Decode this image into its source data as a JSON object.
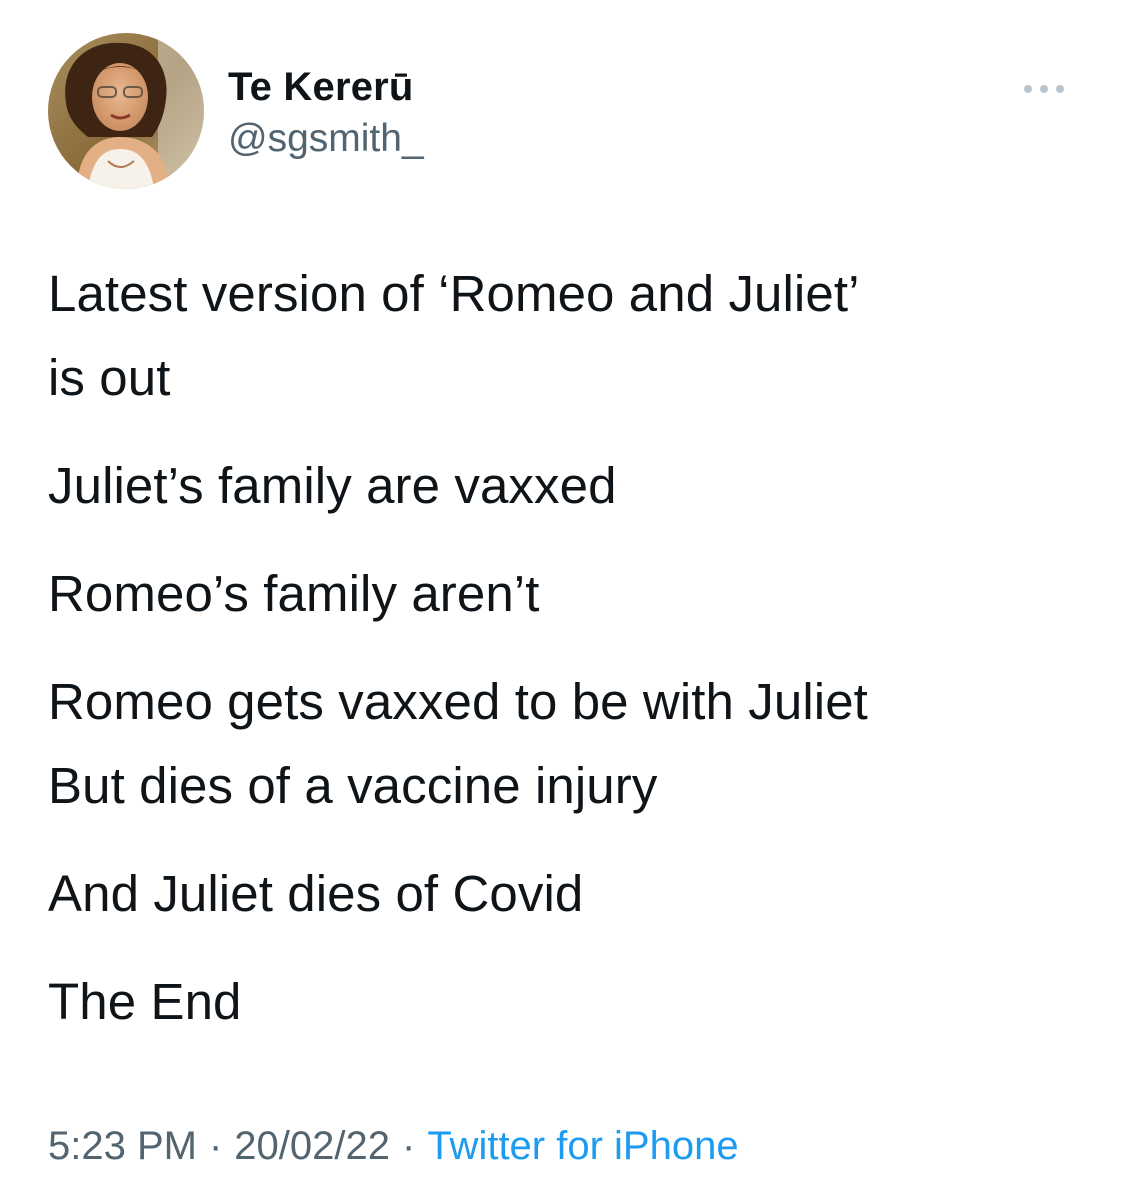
{
  "author": {
    "display_name": "Te Kererū",
    "handle": "@sgsmith_",
    "avatar_icon": "profile-photo"
  },
  "more_icon": "more-horizontal-icon",
  "tweet": {
    "paragraphs": [
      [
        "Latest version of ‘Romeo and Juliet’",
        "is out"
      ],
      [
        "Juliet’s family are vaxxed"
      ],
      [
        "Romeo’s family aren’t"
      ],
      [
        "Romeo gets vaxxed to be with Juliet",
        "But dies of a vaccine injury"
      ],
      [
        "And Juliet dies of Covid"
      ],
      [
        "The End"
      ]
    ]
  },
  "meta": {
    "time": "5:23 PM",
    "separator": "·",
    "date": "20/02/22",
    "source": "Twitter for iPhone"
  },
  "colors": {
    "text_primary": "#0f1419",
    "text_secondary": "#536471",
    "link": "#1d9bf0",
    "more_icon": "#b9c3cc"
  }
}
